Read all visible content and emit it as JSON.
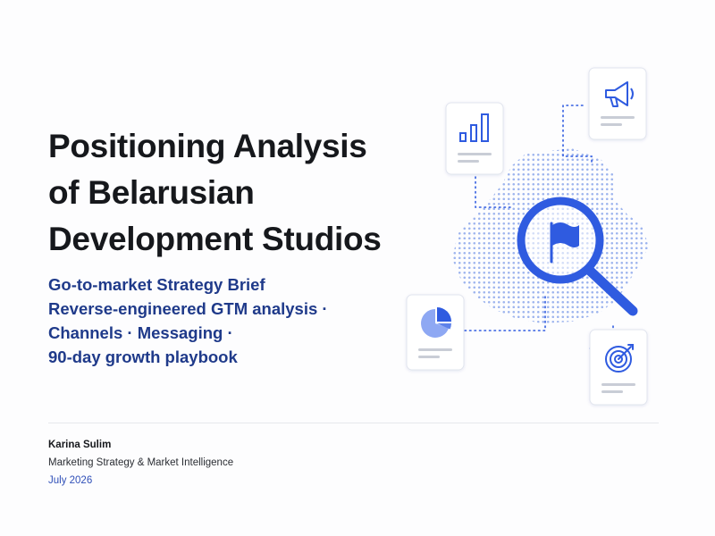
{
  "title_lines": [
    "Positioning Analysis",
    "of Belarusian",
    "Development Studios"
  ],
  "subtitle_lines": [
    "Go-to-market Strategy Brief",
    "Reverse-engineered GTM analysis ·",
    "Channels · Messaging ·",
    "90-day growth playbook"
  ],
  "footer": {
    "author": "Karina Sulim",
    "role": "Marketing Strategy & Market Intelligence",
    "date": "July 2026"
  },
  "colors": {
    "title": "#16181c",
    "subtitle": "#1f3a8a",
    "accent": "#2f5be0",
    "dots": "#9db4ee",
    "date": "#2f4fb8"
  },
  "icons": [
    "bar-chart-icon",
    "megaphone-icon",
    "pie-chart-icon",
    "target-icon",
    "magnifier-icon",
    "flag-icon"
  ]
}
